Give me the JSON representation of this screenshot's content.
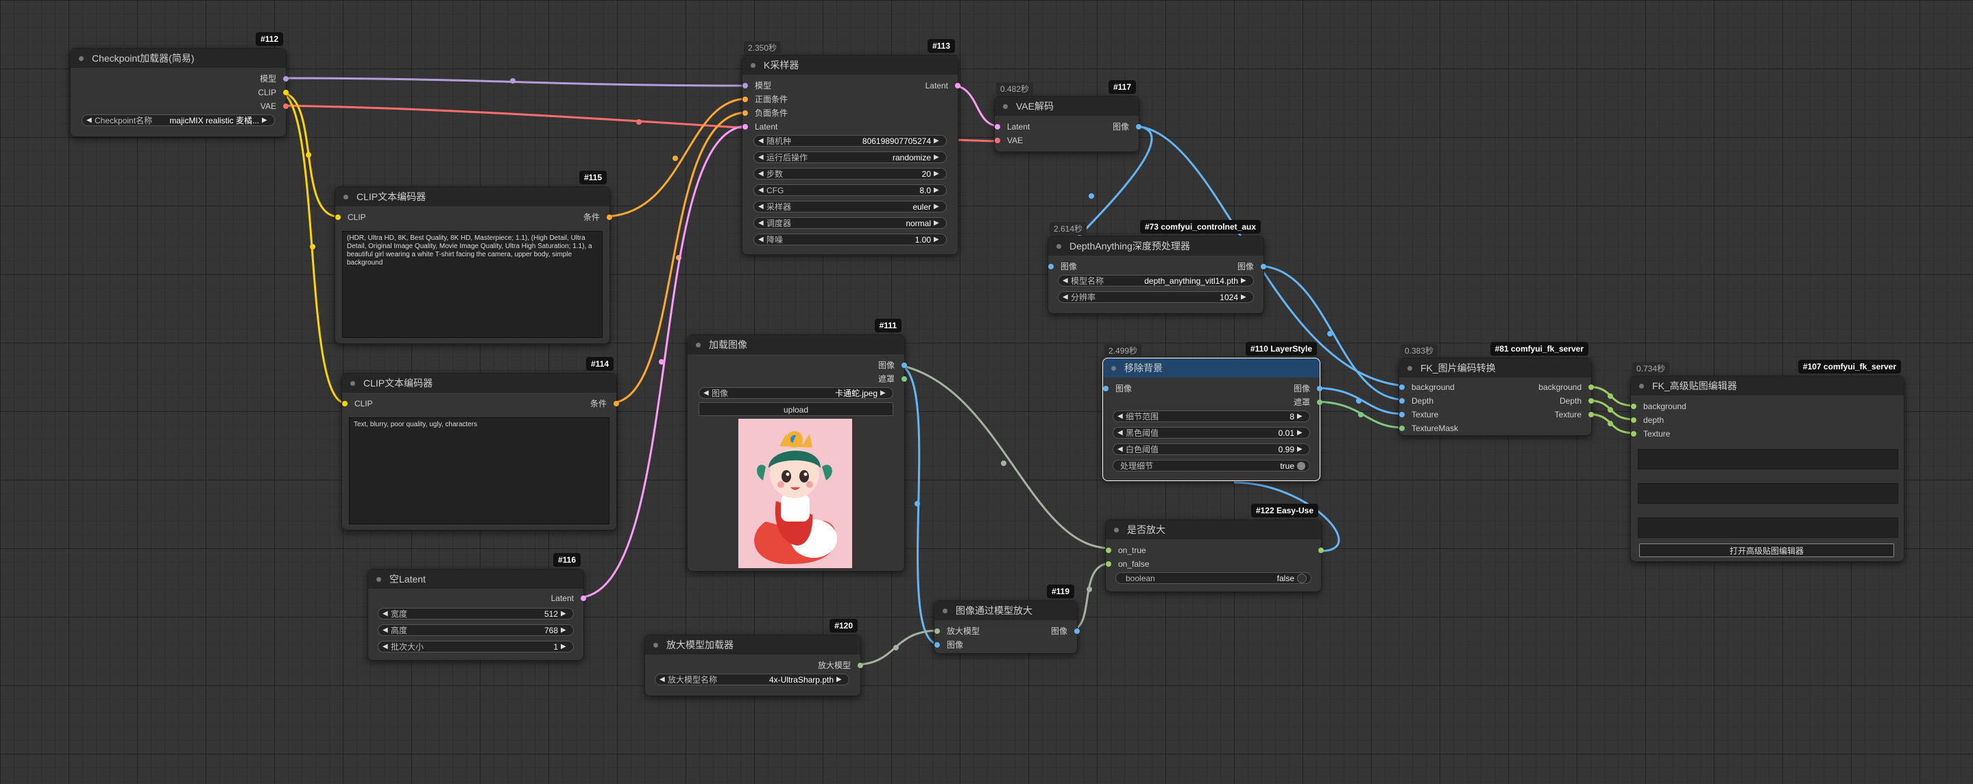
{
  "nodes": {
    "checkpoint": {
      "badge": "#112",
      "title": "Checkpoint加载器(简易)",
      "outputs": [
        "模型",
        "CLIP",
        "VAE"
      ],
      "widget": {
        "label": "Checkpoint名称",
        "value": "majicMIX realistic 麦橘..."
      }
    },
    "clip1": {
      "badge": "#115",
      "title": "CLIP文本编码器",
      "input": "CLIP",
      "output": "条件",
      "text": "(HDR, Ultra HD, 8K, Best Quality, 8K HD, Masterpiece; 1.1), (High Detail, Ultra Detail, Original Image Quality, Movie Image Quality, Ultra High Saturation; 1.1), a beautiful girl wearing a white T-shirt facing the camera, upper body, simple background"
    },
    "clip2": {
      "badge": "#114",
      "title": "CLIP文本编码器",
      "input": "CLIP",
      "output": "条件",
      "text": "Text, blurry, poor quality, ugly, characters"
    },
    "latent": {
      "badge": "#116",
      "title": "空Latent",
      "output": "Latent",
      "widgets": [
        {
          "label": "宽度",
          "value": "512"
        },
        {
          "label": "高度",
          "value": "768"
        },
        {
          "label": "批次大小",
          "value": "1"
        }
      ]
    },
    "ksampler": {
      "badge": "#113",
      "timing": "2.350秒",
      "title": "K采样器",
      "inputs": [
        "模型",
        "正面条件",
        "负面条件",
        "Latent"
      ],
      "output": "Latent",
      "widgets": [
        {
          "label": "随机种",
          "value": "806198907705274"
        },
        {
          "label": "运行后操作",
          "value": "randomize"
        },
        {
          "label": "步数",
          "value": "20"
        },
        {
          "label": "CFG",
          "value": "8.0"
        },
        {
          "label": "采样器",
          "value": "euler"
        },
        {
          "label": "调度器",
          "value": "normal"
        },
        {
          "label": "降噪",
          "value": "1.00"
        }
      ]
    },
    "vaedecode": {
      "badge": "#117",
      "timing": "0.482秒",
      "title": "VAE解码",
      "inputs": [
        "Latent",
        "VAE"
      ],
      "output": "图像"
    },
    "loadimage": {
      "badge": "#111",
      "title": "加载图像",
      "outputs": [
        "图像",
        "遮罩"
      ],
      "widget": {
        "label": "图像",
        "value": "卡通蛇.jpeg"
      },
      "upload": "upload"
    },
    "upscaleloader": {
      "badge": "#120",
      "title": "放大模型加载器",
      "output": "放大模型",
      "widget": {
        "label": "放大模型名称",
        "value": "4x-UltraSharp.pth"
      }
    },
    "upscale": {
      "badge": "#119",
      "title": "图像通过模型放大",
      "inputs": [
        "放大模型",
        "图像"
      ],
      "output": "图像"
    },
    "depth": {
      "badge": "#73 comfyui_controlnet_aux",
      "timing": "2.614秒",
      "title": "DepthAnything深度预处理器",
      "input": "图像",
      "output": "图像",
      "widgets": [
        {
          "label": "模型名称",
          "value": "depth_anything_vitl14.pth"
        },
        {
          "label": "分辨率",
          "value": "1024"
        }
      ]
    },
    "removebg": {
      "badge": "#110 LayerStyle",
      "timing": "2.499秒",
      "title": "移除背景",
      "input": "图像",
      "outputs": [
        "图像",
        "遮罩"
      ],
      "widgets": [
        {
          "label": "细节范围",
          "value": "8"
        },
        {
          "label": "黑色阈值",
          "value": "0.01"
        },
        {
          "label": "白色阈值",
          "value": "0.99"
        },
        {
          "label": "处理细节",
          "value": "true"
        }
      ]
    },
    "ifupscale": {
      "badge": "#122 Easy-Use",
      "title": "是否放大",
      "inputs": [
        "on_true",
        "on_false"
      ],
      "widget": {
        "label": "boolean",
        "value": "false"
      }
    },
    "fkconvert": {
      "badge": "#81 comfyui_fk_server",
      "timing": "0.383秒",
      "title": "FK_图片编码转换",
      "inputs": [
        "background",
        "Depth",
        "Texture",
        "TextureMask"
      ],
      "outputs": [
        "background",
        "Depth",
        "Texture"
      ]
    },
    "fkeditor": {
      "badge": "#107 comfyui_fk_server",
      "timing": "0.734秒",
      "title": "FK_高级贴图编辑器",
      "inputs": [
        "background",
        "depth",
        "Texture"
      ],
      "button": "打开高级贴图编辑器"
    }
  },
  "colors": {
    "model": "#b39ddb",
    "clip": "#ffd500",
    "vae": "#ff6e6e",
    "conditioning": "#ffa931",
    "latent": "#ff9cf9",
    "image": "#64b5f6",
    "mask": "#81c784",
    "upscale_model": "#a5b4a0",
    "generic": "#9ebd8a"
  }
}
